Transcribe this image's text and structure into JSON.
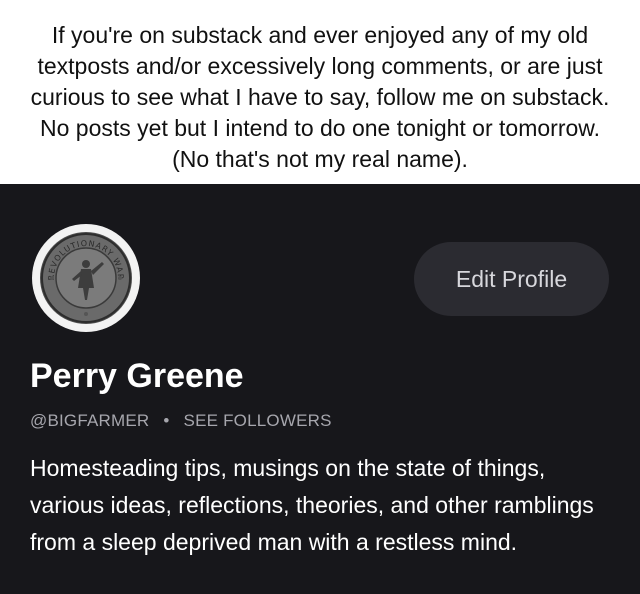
{
  "caption": {
    "text": "If you're on substack and ever enjoyed any of my old textposts and/or excessively long comments, or are just curious to see what I have to say, follow me on substack. No posts yet but I intend to do one tonight or tomorrow. (No that's not my real name)."
  },
  "profile": {
    "avatar": {
      "emblem_text": "REVOLUTIONARY WAR"
    },
    "edit_button_label": "Edit Profile",
    "name": "Perry Greene",
    "handle": "@BIGFARMER",
    "separator": "•",
    "followers_link": "SEE FOLLOWERS",
    "bio": "Homesteading tips, musings on the state of things, various ideas, reflections, theories, and other ramblings from a sleep deprived man with a restless mind."
  },
  "colors": {
    "caption_background": "#ffffff",
    "profile_background": "#17171b",
    "button_background": "#2b2b31",
    "muted_text": "#a6a6ad"
  }
}
